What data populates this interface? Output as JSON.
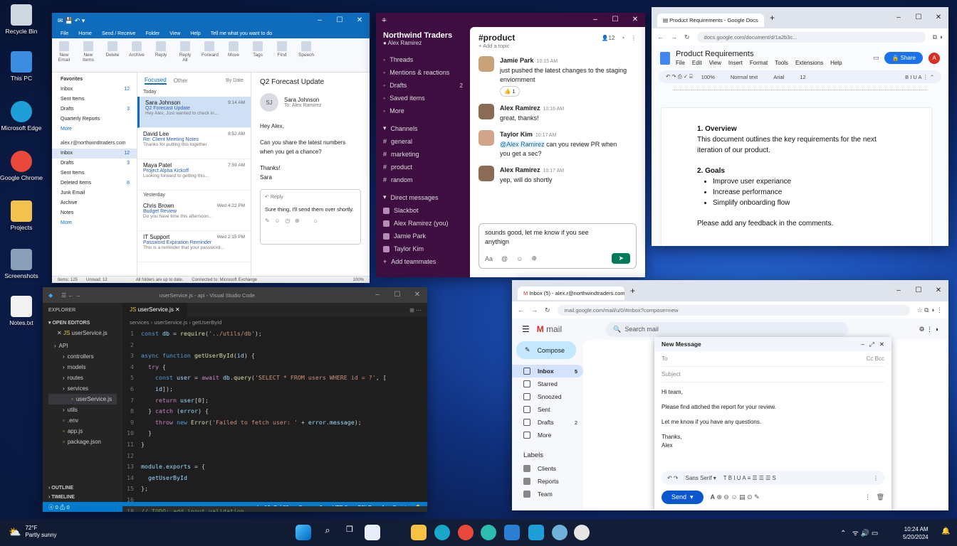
{
  "desktop": {
    "icons": [
      "Recycle Bin",
      "This PC",
      "Microsoft Edge",
      "Google Chrome",
      "Projects",
      "Screenshots",
      "Notes.txt"
    ],
    "icon_colors": [
      "#cfd8e0",
      "#3a8de0",
      "#1f9fd8",
      "#e9483a",
      "#f2c14e",
      "#8aa0b8",
      "#f2f2f2"
    ]
  },
  "outlook": {
    "menu": [
      "File",
      "Home",
      "Send / Receive",
      "Folder",
      "View",
      "Help",
      "Tell me what you want to do"
    ],
    "ribbon": [
      "New Email",
      "New Items",
      "Delete",
      "Archive",
      "Reply",
      "Reply All",
      "Forward",
      "Move",
      "Tags",
      "Find",
      "Speech"
    ],
    "favorites_title": "Favorites",
    "favorites": [
      {
        "n": "Inbox",
        "c": "12"
      },
      {
        "n": "Sent Items",
        "c": ""
      },
      {
        "n": "Drafts",
        "c": "3"
      },
      {
        "n": "Quarterly Reports",
        "c": ""
      },
      {
        "n": "More",
        "c": ""
      }
    ],
    "account": "alex.r@northwindtraders.com",
    "folders": [
      {
        "n": "Inbox",
        "c": "12"
      },
      {
        "n": "Drafts",
        "c": "3"
      },
      {
        "n": "Sent Items",
        "c": ""
      },
      {
        "n": "Deleted Items",
        "c": "8"
      },
      {
        "n": "Junk Email",
        "c": ""
      },
      {
        "n": "Archive",
        "c": ""
      },
      {
        "n": "Notes",
        "c": ""
      },
      {
        "n": "More",
        "c": ""
      }
    ],
    "tab_focused": "Focused",
    "tab_other": "Other",
    "sort": "By Date",
    "group_today": "Today",
    "group_yesterday": "Yesterday",
    "messages": [
      {
        "from": "Sara Johnson",
        "subject": "Q2 Forecast Update",
        "preview": "Hey Alex, Just wanted to check in...",
        "time": "9:14 AM"
      },
      {
        "from": "David Lee",
        "subject": "Re: Client Meeting Notes",
        "preview": "Thanks for putting this together",
        "time": "8:52 AM"
      },
      {
        "from": "Maya Patel",
        "subject": "Project Alpha Kickoff",
        "preview": "Looking forward to getting this...",
        "time": "7:59 AM"
      },
      {
        "from": "Chris Brown",
        "subject": "Budget Review",
        "preview": "Do you have time this afternoon...",
        "time": "Wed 4:22 PM"
      },
      {
        "from": "IT Support",
        "subject": "Password Expiration Reminder",
        "preview": "This is a reminder that your password...",
        "time": "Wed 2:15 PM"
      }
    ],
    "reading": {
      "subject": "Q2 Forecast Update",
      "sender": "Sara Johnson",
      "to": "To: Alex Ramirez",
      "initials": "SJ",
      "body": [
        "Hey Alex,",
        "Can you share the latest numbers when you get a chance?",
        "Thanks!",
        "Sara"
      ],
      "reply_label": "Reply",
      "draft": "Sure thing, I'll send them over shortly."
    },
    "status": {
      "items": "Items: 125",
      "unread": "Unread: 12",
      "sync": "All folders are up to date.",
      "conn": "Connected to: Microsoft Exchange",
      "zoom": "100%"
    }
  },
  "slack": {
    "workspace": "Northwind Traders",
    "user": "Alex Ramirez",
    "nav": [
      "Threads",
      "Mentions & reactions",
      "Drafts",
      "Saved items",
      "More"
    ],
    "drafts_count": "2",
    "channels_title": "Channels",
    "channels": [
      "general",
      "marketing",
      "product",
      "random"
    ],
    "dm_title": "Direct messages",
    "dms": [
      "Slackbot",
      "Alex Ramirez (you)",
      "Jamie Park",
      "Taylor Kim"
    ],
    "add": "Add teammates",
    "channel": "#product",
    "topic": "Add a topic",
    "members": "12",
    "messages": [
      {
        "name": "Jamie Park",
        "time": "10:15 AM",
        "text": "just pushed the latest changes to the staging enviornment"
      },
      {
        "name": "Alex Ramirez",
        "time": "10:16 AM",
        "text": "great, thanks!"
      },
      {
        "name": "Taylor Kim",
        "time": "10:17 AM",
        "mention": "@Alex Ramirez",
        "text": "can you review PR when you get a sec?"
      },
      {
        "name": "Alex Ramirez",
        "time": "10:17 AM",
        "text": "yep, will do shortly"
      }
    ],
    "reaction": "1",
    "composer": "sounds good, let me know if you see anythign"
  },
  "docs": {
    "tab": "Product Requirements - Google Docs",
    "url": "docs.google.com/document/d/1a2b3c...",
    "title": "Product Requirements",
    "share": "Share",
    "avatar": "A",
    "menu": [
      "File",
      "Edit",
      "View",
      "Insert",
      "Format",
      "Tools",
      "Extensions",
      "Help"
    ],
    "zoom": "100%",
    "style": "Normal text",
    "font": "Arial",
    "size": "12",
    "h1": "1. Overview",
    "p1": "This document outlines the key requirements for the next iteration of our product.",
    "h2": "2. Goals",
    "goals": [
      "Improve user experiance",
      "Increase performance",
      "Simplify onboarding flow"
    ],
    "p2": "Please add any feedback in the comments."
  },
  "vscode": {
    "title": "userService.js - api - Visual Studio Code",
    "explorer": "EXPLORER",
    "open_editors": "OPEN EDITORS",
    "open_file": "userService.js",
    "tree": [
      "API",
      "controllers",
      "models",
      "routes",
      "services",
      "userService.js",
      "utils",
      ".env",
      "app.js",
      "package.json"
    ],
    "outline": "OUTLINE",
    "timeline": "TIMELINE",
    "tab": "userService.js",
    "crumbs": [
      "services",
      "userService.js",
      "getUserById"
    ],
    "status": [
      "Ln 18, Col 28",
      "Spaces: 2",
      "UTF-8",
      "CRLF",
      "JavaScript"
    ],
    "problems": "0",
    "warnings": "0"
  },
  "gmail": {
    "tab": "Inbox (5) - alex.r@northwindtraders.com",
    "url": "mail.google.com/mail/u/0/#inbox?compose=new",
    "logo": "mail",
    "search": "Search mail",
    "compose": "Compose",
    "nav": [
      {
        "n": "Inbox",
        "c": "5"
      },
      {
        "n": "Starred",
        "c": ""
      },
      {
        "n": "Snoozed",
        "c": ""
      },
      {
        "n": "Sent",
        "c": ""
      },
      {
        "n": "Drafts",
        "c": "2"
      },
      {
        "n": "More",
        "c": ""
      }
    ],
    "labels_title": "Labels",
    "labels": [
      "Clients",
      "Reports",
      "Team"
    ],
    "new_message": "New Message",
    "to": "To",
    "ccbcc": "Cc Bcc",
    "subject": "Subject",
    "body": [
      "Hi team,",
      "Please find attched the report for your review.",
      "Let me know if you have any questions.",
      "Thanks,",
      "Alex"
    ],
    "font": "Sans Serif",
    "send": "Send"
  },
  "taskbar": {
    "temp": "72°F",
    "weather": "Partly sunny",
    "time": "10:24 AM",
    "date": "5/20/2024"
  }
}
